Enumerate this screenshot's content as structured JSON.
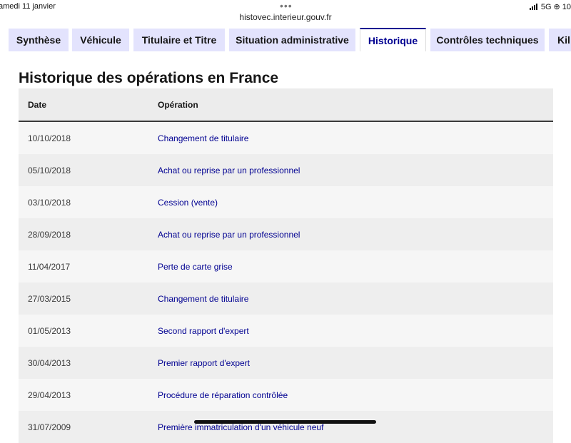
{
  "statusbar": {
    "time_date": "amedi 11 janvier",
    "url": "histovec.interieur.gouv.fr",
    "network": "5G",
    "right_extra": "10",
    "dots": "•••"
  },
  "tabs": [
    {
      "label": "Synthèse"
    },
    {
      "label": "Véhicule"
    },
    {
      "label": "Titulaire et Titre"
    },
    {
      "label": "Situation administrative"
    },
    {
      "label": "Historique",
      "active": true
    },
    {
      "label": "Contrôles techniques"
    },
    {
      "label": "Kil"
    }
  ],
  "main": {
    "title": "Historique des opérations en France",
    "table": {
      "headers": {
        "date": "Date",
        "operation": "Opération"
      },
      "rows": [
        {
          "date": "10/10/2018",
          "operation": "Changement de titulaire"
        },
        {
          "date": "05/10/2018",
          "operation": "Achat ou reprise par un professionnel"
        },
        {
          "date": "03/10/2018",
          "operation": "Cession (vente)"
        },
        {
          "date": "28/09/2018",
          "operation": "Achat ou reprise par un professionnel"
        },
        {
          "date": "11/04/2017",
          "operation": "Perte de carte grise"
        },
        {
          "date": "27/03/2015",
          "operation": "Changement de titulaire"
        },
        {
          "date": "01/05/2013",
          "operation": "Second rapport d'expert"
        },
        {
          "date": "30/04/2013",
          "operation": "Premier rapport d'expert"
        },
        {
          "date": "29/04/2013",
          "operation": "Procédure de réparation contrôlée"
        },
        {
          "date": "31/07/2009",
          "operation": "Première immatriculation d'un véhicule neuf"
        }
      ]
    }
  },
  "colors": {
    "accent": "#000091",
    "tab_bg": "#e3e3fd"
  }
}
